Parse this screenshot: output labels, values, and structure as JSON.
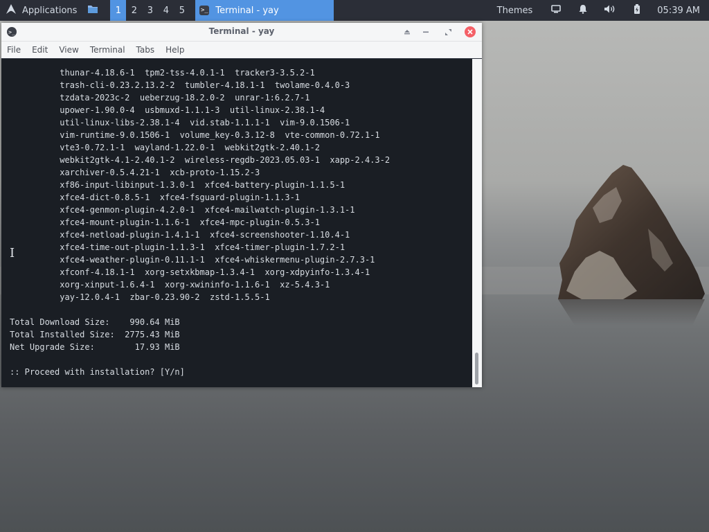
{
  "panel": {
    "apps_label": "Applications",
    "workspaces": [
      "1",
      "2",
      "3",
      "4",
      "5"
    ],
    "active_workspace": "1",
    "task_label": "Terminal - yay",
    "themes_label": "Themes",
    "clock": "05:39 AM",
    "accent_color": "#5294e2"
  },
  "window": {
    "title": "Terminal - yay",
    "menu": [
      "File",
      "Edit",
      "View",
      "Terminal",
      "Tabs",
      "Help"
    ]
  },
  "terminal": {
    "lines": [
      "          thunar-4.18.6-1  tpm2-tss-4.0.1-1  tracker3-3.5.2-1",
      "          trash-cli-0.23.2.13.2-2  tumbler-4.18.1-1  twolame-0.4.0-3",
      "          tzdata-2023c-2  ueberzug-18.2.0-2  unrar-1:6.2.7-1",
      "          upower-1.90.0-4  usbmuxd-1.1.1-3  util-linux-2.38.1-4",
      "          util-linux-libs-2.38.1-4  vid.stab-1.1.1-1  vim-9.0.1506-1",
      "          vim-runtime-9.0.1506-1  volume_key-0.3.12-8  vte-common-0.72.1-1",
      "          vte3-0.72.1-1  wayland-1.22.0-1  webkit2gtk-2.40.1-2",
      "          webkit2gtk-4.1-2.40.1-2  wireless-regdb-2023.05.03-1  xapp-2.4.3-2",
      "          xarchiver-0.5.4.21-1  xcb-proto-1.15.2-3",
      "          xf86-input-libinput-1.3.0-1  xfce4-battery-plugin-1.1.5-1",
      "          xfce4-dict-0.8.5-1  xfce4-fsguard-plugin-1.1.3-1",
      "          xfce4-genmon-plugin-4.2.0-1  xfce4-mailwatch-plugin-1.3.1-1",
      "          xfce4-mount-plugin-1.1.6-1  xfce4-mpc-plugin-0.5.3-1",
      "          xfce4-netload-plugin-1.4.1-1  xfce4-screenshooter-1.10.4-1",
      "          xfce4-time-out-plugin-1.1.3-1  xfce4-timer-plugin-1.7.2-1",
      "          xfce4-weather-plugin-0.11.1-1  xfce4-whiskermenu-plugin-2.7.3-1",
      "          xfconf-4.18.1-1  xorg-setxkbmap-1.3.4-1  xorg-xdpyinfo-1.3.4-1",
      "          xorg-xinput-1.6.4-1  xorg-xwininfo-1.1.6-1  xz-5.4.3-1",
      "          yay-12.0.4-1  zbar-0.23.90-2  zstd-1.5.5-1",
      "",
      "Total Download Size:    990.64 MiB",
      "Total Installed Size:  2775.43 MiB",
      "Net Upgrade Size:        17.93 MiB",
      "",
      ":: Proceed with installation? [Y/n]"
    ]
  }
}
